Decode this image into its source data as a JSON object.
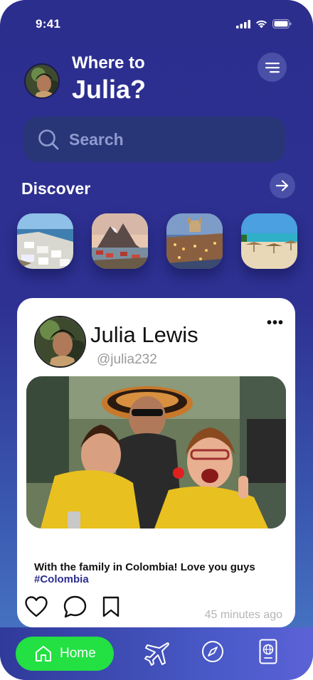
{
  "status_bar": {
    "time": "9:41"
  },
  "header": {
    "greeting_line1": "Where to",
    "greeting_line2": "Julia?"
  },
  "search": {
    "placeholder": "Search"
  },
  "discover": {
    "title": "Discover",
    "places": [
      {
        "name": "santorini-photo"
      },
      {
        "name": "lofoten-photo"
      },
      {
        "name": "toledo-photo"
      },
      {
        "name": "beach-photo"
      }
    ]
  },
  "post": {
    "author_name": "Julia Lewis",
    "author_handle": "@julia232",
    "caption": "With the family in Colombia! Love you guys",
    "hashtag": "#Colombia",
    "time_ago": "45 minutes ago",
    "more_label": "•••"
  },
  "nav": {
    "home_label": "Home",
    "items": [
      "home-icon",
      "plane-icon",
      "compass-icon",
      "passport-icon"
    ]
  },
  "colors": {
    "background": "#2e3192",
    "accent_green": "#23e043",
    "hashtag": "#2c2e8e"
  }
}
